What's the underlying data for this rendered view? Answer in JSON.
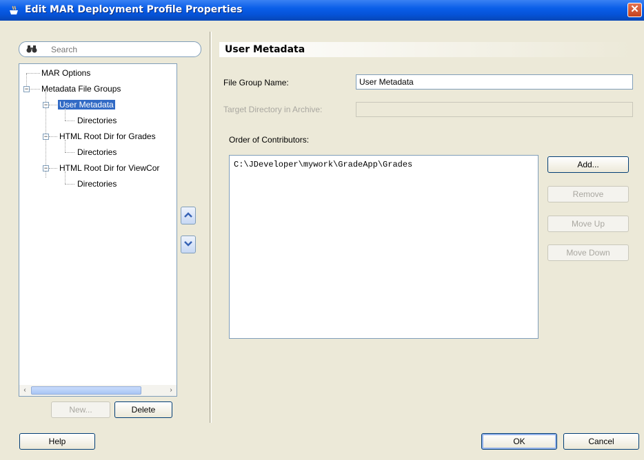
{
  "window": {
    "title": "Edit MAR Deployment Profile Properties",
    "close_glyph": "✕"
  },
  "search": {
    "placeholder": "Search"
  },
  "tree": {
    "items": [
      {
        "label": "MAR Options"
      },
      {
        "label": "Metadata File Groups"
      },
      {
        "label": "User Metadata"
      },
      {
        "label": "Directories"
      },
      {
        "label": "HTML Root Dir for Grades"
      },
      {
        "label": "Directories"
      },
      {
        "label": "HTML Root Dir for ViewCor"
      },
      {
        "label": "Directories"
      }
    ]
  },
  "side_buttons": {
    "new": "New...",
    "delete": "Delete"
  },
  "panel": {
    "header": "User Metadata",
    "file_group_name_label": "File Group Name:",
    "file_group_name_value": "User Metadata",
    "target_dir_label": "Target Directory in Archive:",
    "target_dir_value": "",
    "contributors_label": "Order of Contributors:",
    "contributors": [
      "C:\\JDeveloper\\mywork\\GradeApp\\Grades"
    ],
    "buttons": {
      "add": "Add...",
      "remove": "Remove",
      "move_up": "Move Up",
      "move_down": "Move Down"
    }
  },
  "footer": {
    "help": "Help",
    "ok": "OK",
    "cancel": "Cancel"
  },
  "icons": {
    "title": "java-cup-icon",
    "search": "binoculars-icon",
    "up": "chevron-up-icon",
    "down": "chevron-down-icon"
  },
  "colors": {
    "titlebar": "#0a5ee8",
    "selection": "#316ac5",
    "close": "#c4421d"
  }
}
